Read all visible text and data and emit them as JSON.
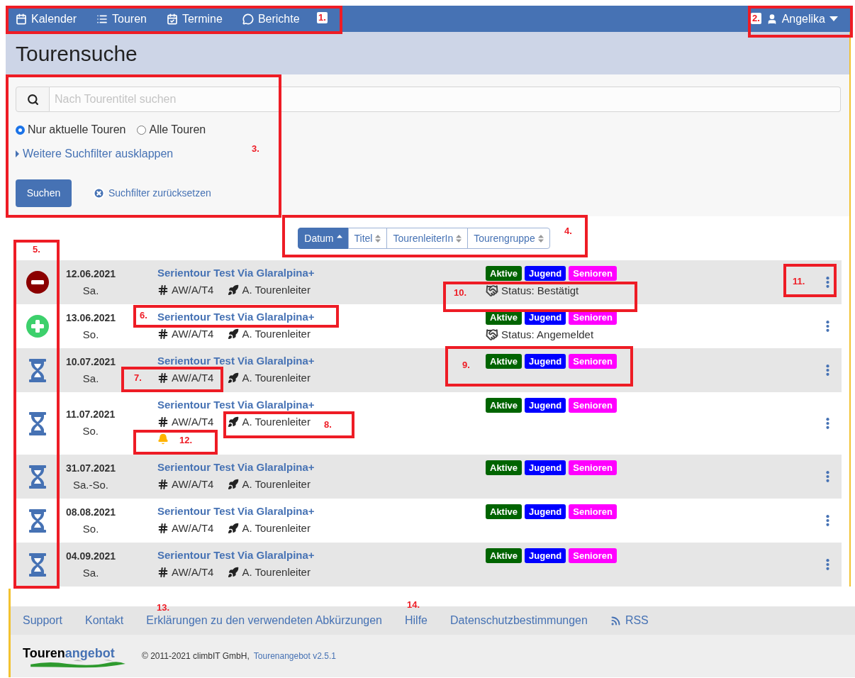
{
  "top_nav": {
    "items": [
      {
        "label": "Kalender"
      },
      {
        "label": "Touren"
      },
      {
        "label": "Termine"
      },
      {
        "label": "Berichte"
      }
    ],
    "user": "Angelika"
  },
  "page_title": "Tourensuche",
  "search": {
    "placeholder": "Nach Tourentitel suchen",
    "radios": [
      {
        "label": "Nur aktuelle Touren",
        "selected": true
      },
      {
        "label": "Alle Touren",
        "selected": false
      }
    ],
    "more_filters": "Weitere Suchfilter ausklappen",
    "submit": "Suchen",
    "reset": "Suchfilter zurücksetzen"
  },
  "sort": [
    {
      "label": "Datum",
      "selected": true
    },
    {
      "label": "Titel",
      "selected": false
    },
    {
      "label": "TourenleiterIn",
      "selected": false
    },
    {
      "label": "Tourengruppe",
      "selected": false
    }
  ],
  "tours": [
    {
      "kind": "minus",
      "date": "12.06.2021",
      "weekday": "Sa.",
      "title": "Serientour Test Via Glaralpina+",
      "grade": "AW/A/T4",
      "leader": "A. Tourenleiter",
      "alert": false,
      "tags": [
        {
          "label": "Aktive",
          "color": "#006400"
        },
        {
          "label": "Jugend",
          "color": "#0000ff"
        },
        {
          "label": "Senioren",
          "color": "#ff00ff"
        }
      ],
      "status": "Status: Bestätigt"
    },
    {
      "kind": "plus",
      "date": "13.06.2021",
      "weekday": "So.",
      "title": "Serientour Test Via Glaralpina+",
      "grade": "AW/A/T4",
      "leader": "A. Tourenleiter",
      "alert": false,
      "tags": [
        {
          "label": "Aktive",
          "color": "#006400"
        },
        {
          "label": "Jugend",
          "color": "#0000ff"
        },
        {
          "label": "Senioren",
          "color": "#ff00ff"
        }
      ],
      "status": "Status: Angemeldet"
    },
    {
      "kind": "hourglass",
      "date": "10.07.2021",
      "weekday": "Sa.",
      "title": "Serientour Test Via Glaralpina+",
      "grade": "AW/A/T4",
      "leader": "A. Tourenleiter",
      "alert": false,
      "tags": [
        {
          "label": "Aktive",
          "color": "#006400"
        },
        {
          "label": "Jugend",
          "color": "#0000ff"
        },
        {
          "label": "Senioren",
          "color": "#ff00ff"
        }
      ]
    },
    {
      "kind": "hourglass",
      "date": "11.07.2021",
      "weekday": "So.",
      "title": "Serientour Test Via Glaralpina+",
      "grade": "AW/A/T4",
      "leader": "A. Tourenleiter",
      "alert": true,
      "tags": [
        {
          "label": "Aktive",
          "color": "#006400"
        },
        {
          "label": "Jugend",
          "color": "#0000ff"
        },
        {
          "label": "Senioren",
          "color": "#ff00ff"
        }
      ]
    },
    {
      "kind": "hourglass",
      "date": "31.07.2021",
      "weekday": "Sa.-So.",
      "title": "Serientour Test Via Glaralpina+",
      "grade": "AW/A/T4",
      "leader": "A. Tourenleiter",
      "alert": false,
      "tags": [
        {
          "label": "Aktive",
          "color": "#006400"
        },
        {
          "label": "Jugend",
          "color": "#0000ff"
        },
        {
          "label": "Senioren",
          "color": "#ff00ff"
        }
      ]
    },
    {
      "kind": "hourglass",
      "date": "08.08.2021",
      "weekday": "So.",
      "title": "Serientour Test Via Glaralpina+",
      "grade": "AW/A/T4",
      "leader": "A. Tourenleiter",
      "alert": false,
      "tags": [
        {
          "label": "Aktive",
          "color": "#006400"
        },
        {
          "label": "Jugend",
          "color": "#0000ff"
        },
        {
          "label": "Senioren",
          "color": "#ff00ff"
        }
      ]
    },
    {
      "kind": "hourglass",
      "date": "04.09.2021",
      "weekday": "Sa.",
      "title": "Serientour Test Via Glaralpina+",
      "grade": "AW/A/T4",
      "leader": "A. Tourenleiter",
      "alert": false,
      "tags": [
        {
          "label": "Aktive",
          "color": "#006400"
        },
        {
          "label": "Jugend",
          "color": "#0000ff"
        },
        {
          "label": "Senioren",
          "color": "#ff00ff"
        }
      ]
    }
  ],
  "footer": {
    "links": [
      {
        "label": "Support",
        "kind": "link"
      },
      {
        "label": "Kontakt",
        "kind": "link"
      },
      {
        "label": "Erklärungen zu den verwendeten Abkürzungen",
        "kind": "link"
      },
      {
        "label": "Hilfe",
        "kind": "link"
      },
      {
        "label": "Datenschutzbestimmungen",
        "kind": "link"
      },
      {
        "label": "RSS",
        "kind": "rss"
      }
    ],
    "logo": [
      "Touren",
      "angebot"
    ],
    "copyright": "© 2011-2021 climbIT GmbH,",
    "version_link": "Tourenangebot v2.5.1"
  },
  "annotations": [
    {
      "label": "1.",
      "boxed": true
    },
    {
      "label": "2.",
      "boxed": true
    },
    {
      "label": "3.",
      "boxed": true
    },
    {
      "label": "4.",
      "boxed": true
    },
    {
      "label": "5.",
      "boxed": true
    },
    {
      "label": "6.",
      "boxed": true
    },
    {
      "label": "7.",
      "boxed": true
    },
    {
      "label": "8.",
      "boxed": true
    },
    {
      "label": "9.",
      "boxed": true
    },
    {
      "label": "10.",
      "boxed": true
    },
    {
      "label": "11.",
      "boxed": true
    },
    {
      "label": "12.",
      "boxed": true
    },
    {
      "label": "13.",
      "boxed": false
    },
    {
      "label": "14.",
      "boxed": false
    }
  ]
}
